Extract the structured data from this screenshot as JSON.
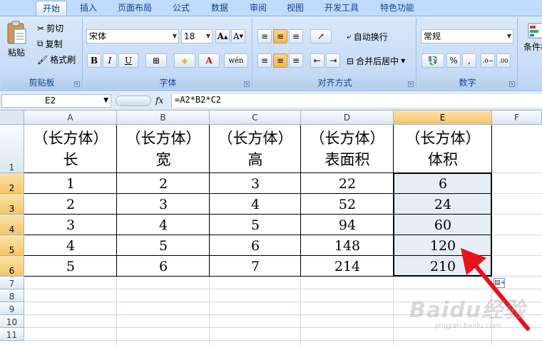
{
  "ribbon": {
    "tabs": [
      "开始",
      "插入",
      "页面布局",
      "公式",
      "数据",
      "审阅",
      "视图",
      "开发工具",
      "特色功能"
    ],
    "active_tab": "开始",
    "clipboard": {
      "paste": "粘贴",
      "cut": "剪切",
      "copy": "复制",
      "format_painter": "格式刷",
      "label": "剪贴板"
    },
    "font": {
      "name": "宋体",
      "size": "18",
      "bold": "B",
      "italic": "I",
      "underline": "U",
      "phonetic": "wén",
      "label": "字体"
    },
    "alignment": {
      "wrap": "自动换行",
      "merge": "合并后居中",
      "label": "对齐方式"
    },
    "number": {
      "format": "常规",
      "percent": "%",
      "comma": ",",
      "label": "数字"
    },
    "styles": {
      "conditional": "条件格"
    }
  },
  "formula_bar": {
    "name_box": "E2",
    "fx": "fx",
    "formula": "=A2*B2*C2"
  },
  "sheet": {
    "columns": [
      "A",
      "B",
      "C",
      "D",
      "E",
      "F"
    ],
    "rows": [
      "1",
      "2",
      "3",
      "4",
      "5",
      "6",
      "7",
      "8",
      "9",
      "10",
      "11"
    ],
    "headers": [
      {
        "line1": "（长方体）",
        "line2": "长"
      },
      {
        "line1": "（长方体）",
        "line2": "宽"
      },
      {
        "line1": "（长方体）",
        "line2": "高"
      },
      {
        "line1": "（长方体）",
        "line2": "表面积"
      },
      {
        "line1": "（长方体）",
        "line2": "体积"
      }
    ],
    "data": [
      [
        "1",
        "2",
        "3",
        "22",
        "6"
      ],
      [
        "2",
        "3",
        "4",
        "52",
        "24"
      ],
      [
        "3",
        "4",
        "5",
        "94",
        "60"
      ],
      [
        "4",
        "5",
        "6",
        "148",
        "120"
      ],
      [
        "5",
        "6",
        "7",
        "214",
        "210"
      ]
    ],
    "selected_range": "E2:E6",
    "annotation_color": "#e8121c"
  },
  "watermark": {
    "text": "Baidu经验",
    "url": "jingyan.baidu.com"
  }
}
